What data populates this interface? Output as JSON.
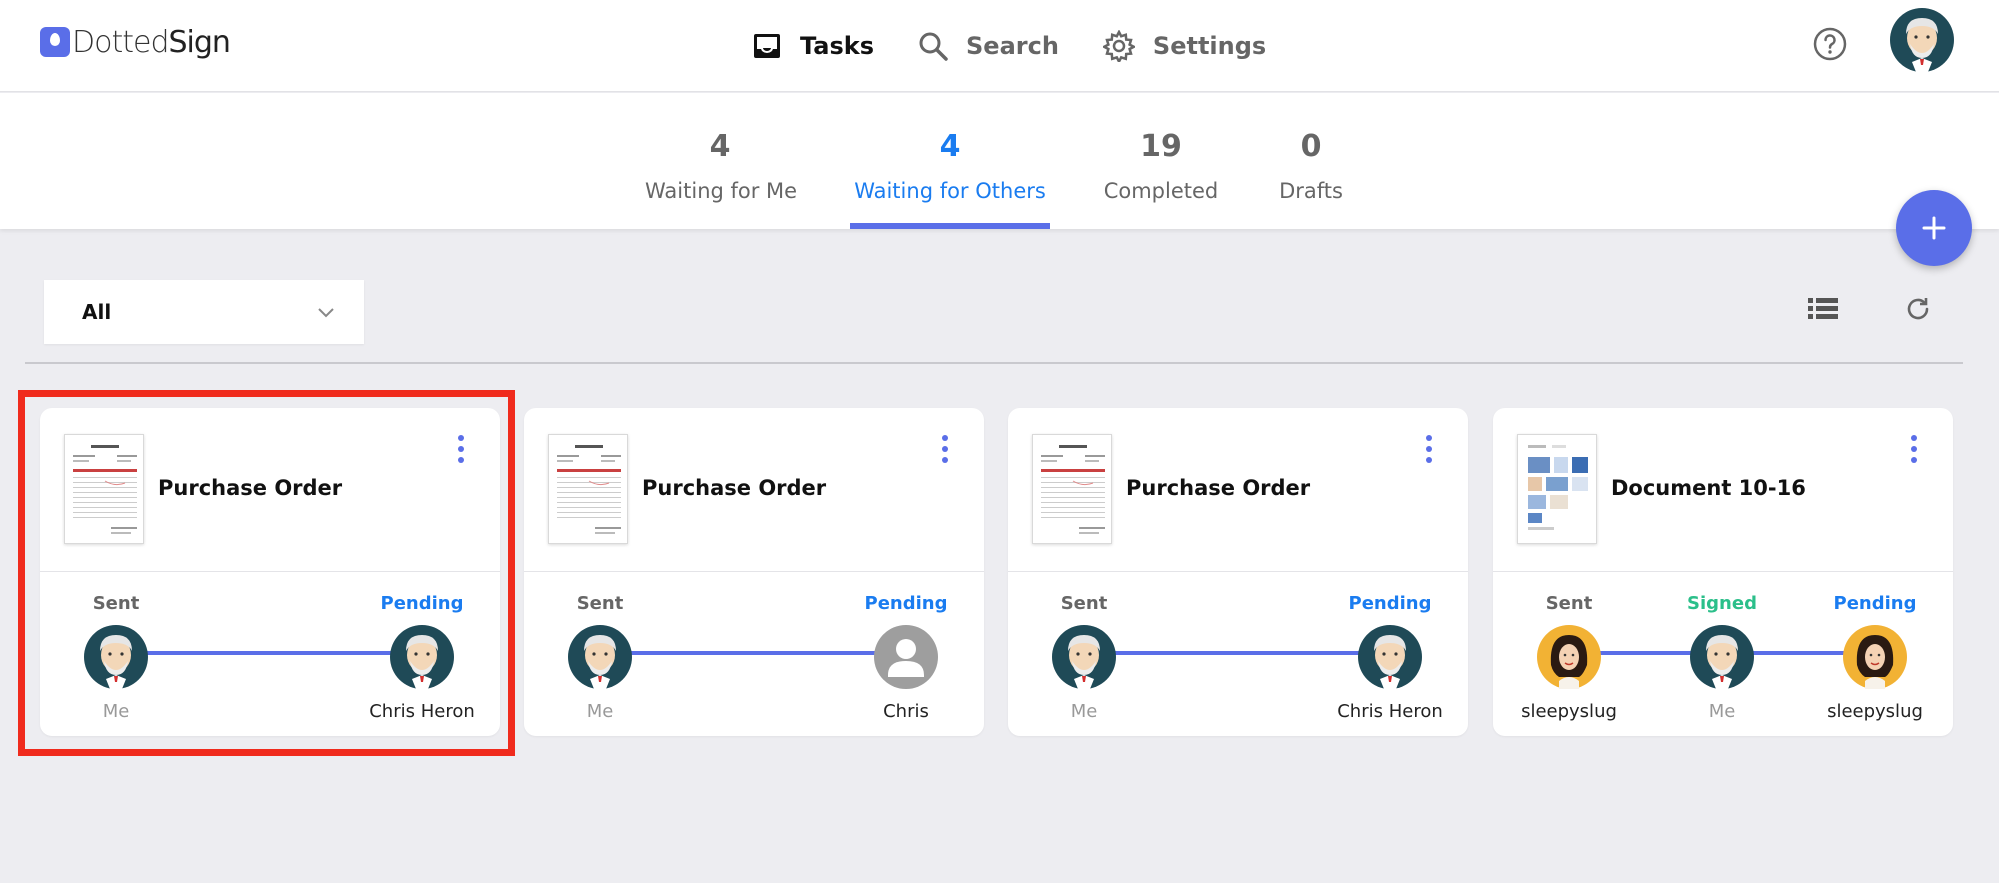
{
  "app": {
    "logo_text_a": "Dotted",
    "logo_text_b": "Sign"
  },
  "nav": [
    {
      "label": "Tasks",
      "icon": "inbox-icon",
      "active": true
    },
    {
      "label": "Search",
      "icon": "search-icon",
      "active": false
    },
    {
      "label": "Settings",
      "icon": "gear-icon",
      "active": false
    }
  ],
  "tabs": [
    {
      "count": "4",
      "label": "Waiting for Me"
    },
    {
      "count": "4",
      "label": "Waiting for Others"
    },
    {
      "count": "19",
      "label": "Completed"
    },
    {
      "count": "0",
      "label": "Drafts"
    }
  ],
  "filter": {
    "selected": "All"
  },
  "colors": {
    "accent": "#5a6ee8",
    "pending": "#1a7cf0",
    "signed": "#2bbf8a",
    "highlight": "#f02b1d"
  },
  "cards": [
    {
      "title": "Purchase Order",
      "steps": [
        {
          "status": "Sent",
          "name": "Me"
        },
        {
          "status": "Pending",
          "name": "Chris Heron"
        }
      ]
    },
    {
      "title": "Purchase Order",
      "steps": [
        {
          "status": "Sent",
          "name": "Me"
        },
        {
          "status": "Pending",
          "name": "Chris"
        }
      ]
    },
    {
      "title": "Purchase Order",
      "steps": [
        {
          "status": "Sent",
          "name": "Me"
        },
        {
          "status": "Pending",
          "name": "Chris Heron"
        }
      ]
    },
    {
      "title": "Document 10-16",
      "steps": [
        {
          "status": "Sent",
          "name": "sleepyslug"
        },
        {
          "status": "Signed",
          "name": "Me"
        },
        {
          "status": "Pending",
          "name": "sleepyslug"
        }
      ]
    }
  ]
}
